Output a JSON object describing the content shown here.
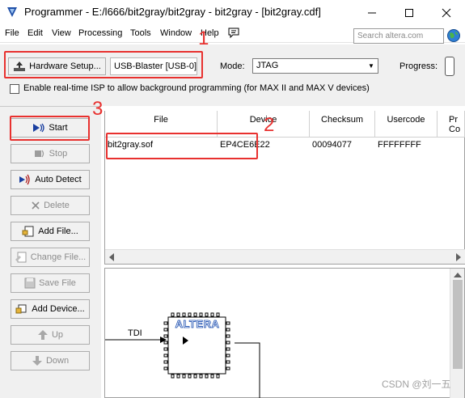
{
  "window": {
    "title": "Programmer - E:/l666/bit2gray/bit2gray - bit2gray - [bit2gray.cdf]",
    "minimize_icon": "minimize-icon",
    "maximize_icon": "maximize-icon",
    "close_icon": "close-icon"
  },
  "menu": {
    "items": [
      "File",
      "Edit",
      "View",
      "Processing",
      "Tools",
      "Window",
      "Help"
    ],
    "search_placeholder": "Search altera.com"
  },
  "setup": {
    "hardware_button": "Hardware Setup...",
    "hardware_value": "USB-Blaster [USB-0]",
    "mode_label": "Mode:",
    "mode_value": "JTAG",
    "progress_label": "Progress:",
    "progress_value": 0,
    "isp_label": "Enable real-time ISP to allow background programming (for MAX II and MAX V devices)",
    "isp_checked": false
  },
  "sidebar": {
    "buttons": [
      {
        "label": "Start",
        "icon": "start-icon",
        "enabled": true
      },
      {
        "label": "Stop",
        "icon": "stop-icon",
        "enabled": false
      },
      {
        "label": "Auto Detect",
        "icon": "auto-detect-icon",
        "enabled": true
      },
      {
        "label": "Delete",
        "icon": "delete-icon",
        "enabled": false
      },
      {
        "label": "Add File...",
        "icon": "add-file-icon",
        "enabled": true
      },
      {
        "label": "Change File...",
        "icon": "change-file-icon",
        "enabled": false
      },
      {
        "label": "Save File",
        "icon": "save-file-icon",
        "enabled": false
      },
      {
        "label": "Add Device...",
        "icon": "add-device-icon",
        "enabled": true
      },
      {
        "label": "Up",
        "icon": "up-icon",
        "enabled": false
      },
      {
        "label": "Down",
        "icon": "down-icon",
        "enabled": false
      }
    ]
  },
  "table": {
    "columns": [
      "File",
      "Device",
      "Checksum",
      "Usercode",
      "Pr Co"
    ],
    "rows": [
      {
        "file": "bit2gray.sof",
        "device": "EP4CE6E22",
        "checksum": "00094077",
        "usercode": "FFFFFFFF"
      }
    ]
  },
  "diagram": {
    "tdi_label": "TDI",
    "chip_brand": "ALTERA"
  },
  "annotations": {
    "marker_1": "1",
    "marker_2": "2",
    "marker_3": "3",
    "color": "#e8312f"
  },
  "watermark": "CSDN @刘一五"
}
